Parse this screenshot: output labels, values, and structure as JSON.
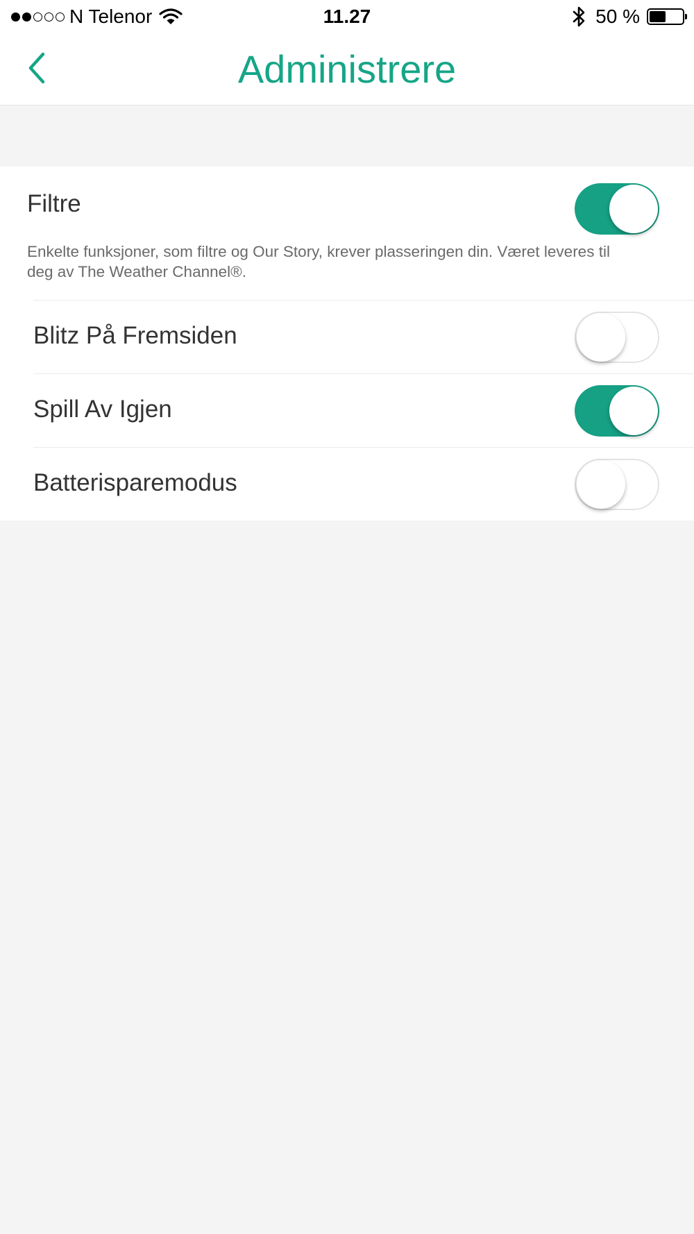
{
  "status_bar": {
    "signal_strength": 2,
    "signal_total": 5,
    "carrier": "N Telenor",
    "wifi_icon": "wifi-icon",
    "time": "11.27",
    "bluetooth_icon": "bluetooth-icon",
    "battery_percent_text": "50 %",
    "battery_level": 0.5
  },
  "nav": {
    "back_icon": "chevron-left-icon",
    "title": "Administrere",
    "accent_color": "#16a587"
  },
  "settings": {
    "toggle_on_color": "#16a084",
    "items": [
      {
        "label": "Filtre",
        "description": "Enkelte funksjoner, som filtre og Our Story, krever plasseringen din. Været leveres til deg av The Weather Channel®.",
        "enabled": true
      },
      {
        "label": "Blitz På Fremsiden",
        "enabled": false
      },
      {
        "label": "Spill Av Igjen",
        "enabled": true
      },
      {
        "label": "Batterisparemodus",
        "enabled": false
      }
    ]
  }
}
